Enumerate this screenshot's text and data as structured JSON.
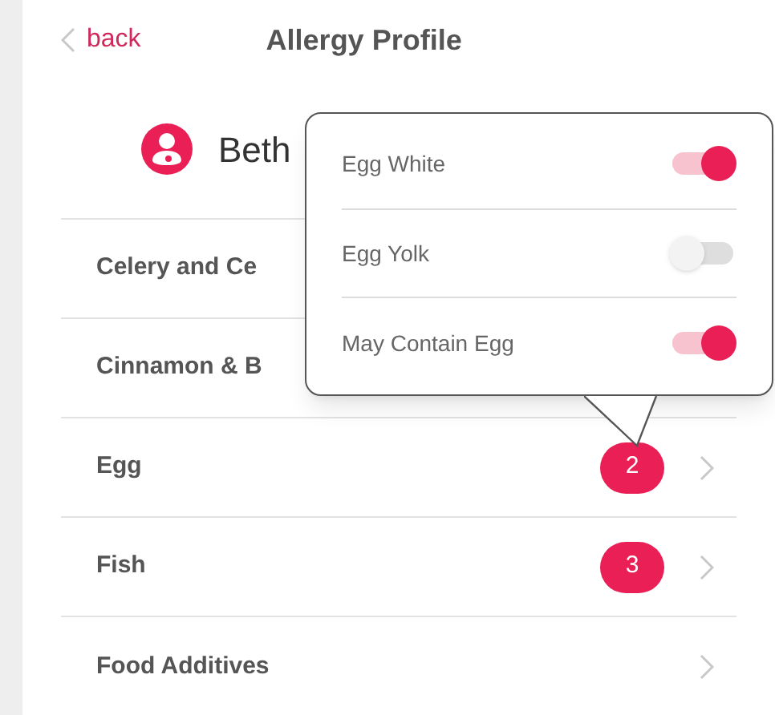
{
  "header": {
    "back": "back",
    "title": "Allergy Profile"
  },
  "profile": {
    "name": "Beth"
  },
  "allergens": [
    {
      "label": "Celery and Ce",
      "chevron": false
    },
    {
      "label": "Cinnamon & B",
      "chevron": false
    },
    {
      "label": "Egg",
      "count": "2",
      "chevron": true
    },
    {
      "label": "Fish",
      "count": "3",
      "chevron": true
    },
    {
      "label": "Food Additives",
      "chevron": true
    }
  ],
  "popover": {
    "items": [
      {
        "label": "Egg White",
        "on": true
      },
      {
        "label": "Egg Yolk",
        "on": false
      },
      {
        "label": "May Contain Egg",
        "on": true
      }
    ]
  }
}
